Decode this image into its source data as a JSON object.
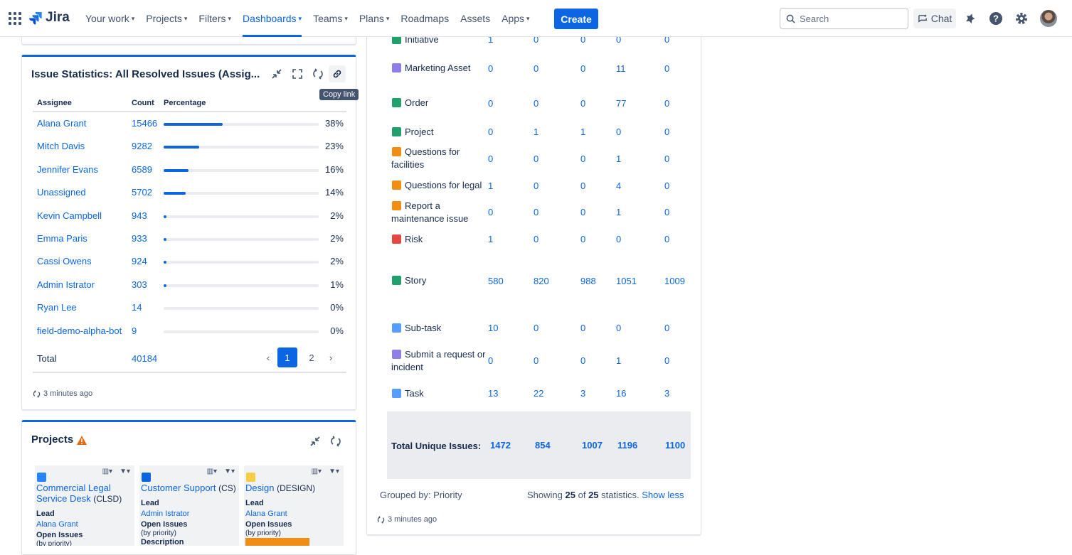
{
  "nav": {
    "logo": "Jira",
    "items": [
      {
        "label": "Your work",
        "chevron": true,
        "active": false
      },
      {
        "label": "Projects",
        "chevron": true,
        "active": false
      },
      {
        "label": "Filters",
        "chevron": true,
        "active": false
      },
      {
        "label": "Dashboards",
        "chevron": true,
        "active": true
      },
      {
        "label": "Teams",
        "chevron": true,
        "active": false
      },
      {
        "label": "Plans",
        "chevron": true,
        "active": false
      },
      {
        "label": "Roadmaps",
        "chevron": false,
        "active": false
      },
      {
        "label": "Assets",
        "chevron": false,
        "active": false
      },
      {
        "label": "Apps",
        "chevron": true,
        "active": false
      }
    ],
    "create_label": "Create",
    "search_placeholder": "Search",
    "chat_label": "Chat",
    "accent": "#0c66e4"
  },
  "issue_stats": {
    "title": "Issue Statistics: All Resolved Issues (Assig...",
    "tooltip": "Copy link",
    "headers": {
      "assignee": "Assignee",
      "count": "Count",
      "percentage": "Percentage"
    },
    "rows": [
      {
        "name": "Alana Grant",
        "count": "15466",
        "pct": "38%",
        "fraction": 0.38
      },
      {
        "name": "Mitch Davis",
        "count": "9282",
        "pct": "23%",
        "fraction": 0.23
      },
      {
        "name": "Jennifer Evans",
        "count": "6589",
        "pct": "16%",
        "fraction": 0.16
      },
      {
        "name": "Unassigned",
        "count": "5702",
        "pct": "14%",
        "fraction": 0.14
      },
      {
        "name": "Kevin Campbell",
        "count": "943",
        "pct": "2%",
        "fraction": 0.02
      },
      {
        "name": "Emma Paris",
        "count": "933",
        "pct": "2%",
        "fraction": 0.02
      },
      {
        "name": "Cassi Owens",
        "count": "924",
        "pct": "2%",
        "fraction": 0.02
      },
      {
        "name": "Admin Istrator",
        "count": "303",
        "pct": "1%",
        "fraction": 0.01
      },
      {
        "name": "Ryan Lee",
        "count": "14",
        "pct": "0%",
        "fraction": 0
      },
      {
        "name": "field-demo-alpha-bot",
        "count": "9",
        "pct": "0%",
        "fraction": 0
      }
    ],
    "total_label": "Total",
    "total_value": "40184",
    "pages": [
      "1",
      "2"
    ],
    "current_page": "1",
    "updated": "3 minutes ago"
  },
  "projects": {
    "title": "Projects",
    "cards": [
      {
        "icon_color": "#2684ff",
        "name": "Commercial Legal Service Desk",
        "key": "(CLSD)",
        "lead_label": "Lead",
        "lead": "Alana Grant",
        "open_label": "Open Issues",
        "open_sub": "(by priority)",
        "extra": ""
      },
      {
        "icon_color": "#0c66e4",
        "name": "Customer Support",
        "key": "(CS)",
        "lead_label": "Lead",
        "lead": "Admin Istrator",
        "open_label": "Open Issues",
        "open_sub": "(by priority)",
        "extra": "Description"
      },
      {
        "icon_color": "#f5cd47",
        "name": "Design",
        "key": "(DESIGN)",
        "lead_label": "Lead",
        "lead": "Alana Grant",
        "open_label": "Open Issues",
        "open_sub": "(by priority)",
        "extra": ""
      }
    ]
  },
  "type_stats": {
    "rows": [
      {
        "name": "Initiative",
        "icon": "#22a06b",
        "v": [
          "1",
          "0",
          "0",
          "0",
          "0"
        ]
      },
      {
        "name": "Marketing Asset",
        "icon": "#8f7ee7",
        "v": [
          "0",
          "0",
          "0",
          "11",
          "0"
        ]
      },
      {
        "name": "Order",
        "icon": "#22a06b",
        "v": [
          "0",
          "0",
          "0",
          "77",
          "0"
        ]
      },
      {
        "name": "Project",
        "icon": "#22a06b",
        "v": [
          "0",
          "1",
          "1",
          "0",
          "0"
        ]
      },
      {
        "name": "Questions for facilities",
        "icon": "#f18d13",
        "v": [
          "0",
          "0",
          "0",
          "1",
          "0"
        ]
      },
      {
        "name": "Questions for legal",
        "icon": "#f18d13",
        "v": [
          "1",
          "0",
          "0",
          "4",
          "0"
        ]
      },
      {
        "name": "Report a maintenance issue",
        "icon": "#f18d13",
        "v": [
          "0",
          "0",
          "0",
          "1",
          "0"
        ]
      },
      {
        "name": "Risk",
        "icon": "#e2483d",
        "v": [
          "1",
          "0",
          "0",
          "0",
          "0"
        ]
      },
      {
        "name": "Story",
        "icon": "#22a06b",
        "v": [
          "580",
          "820",
          "988",
          "1051",
          "1009"
        ]
      },
      {
        "name": "Sub-task",
        "icon": "#579dff",
        "v": [
          "10",
          "0",
          "0",
          "0",
          "0"
        ]
      },
      {
        "name": "Submit a request or incident",
        "icon": "#8f7ee7",
        "v": [
          "0",
          "0",
          "0",
          "1",
          "0"
        ]
      },
      {
        "name": "Task",
        "icon": "#579dff",
        "v": [
          "13",
          "22",
          "3",
          "16",
          "3"
        ]
      }
    ],
    "total_label": "Total Unique Issues:",
    "totals": [
      "1472",
      "854",
      "1007",
      "1196",
      "1100"
    ],
    "grouped_by": "Grouped by: Priority",
    "showing_prefix": "Showing",
    "showing_count": "25",
    "showing_of": "of",
    "showing_total": "25",
    "showing_suffix": "statistics.",
    "show_less": "Show less",
    "updated": "3 minutes ago"
  }
}
